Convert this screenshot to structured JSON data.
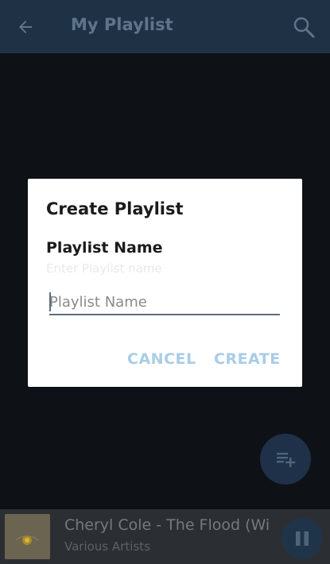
{
  "appbar": {
    "title": "My Playlist"
  },
  "dialog": {
    "title": "Create Playlist",
    "label": "Playlist Name",
    "hint": "Enter Playlist name",
    "input_placeholder": "Playlist Name",
    "input_value": "",
    "cancel_label": "CANCEL",
    "create_label": "CREATE"
  },
  "now_playing": {
    "title": "Cheryl Cole - The Flood (Wi",
    "artist": "Various Artists"
  },
  "icons": {
    "back": "arrow-left-icon",
    "search": "search-icon",
    "fab": "playlist-add-icon",
    "pause": "pause-icon"
  },
  "colors": {
    "appbar": "#1f3245",
    "accent_button": "#a8cde6",
    "background": "#0e1116"
  }
}
